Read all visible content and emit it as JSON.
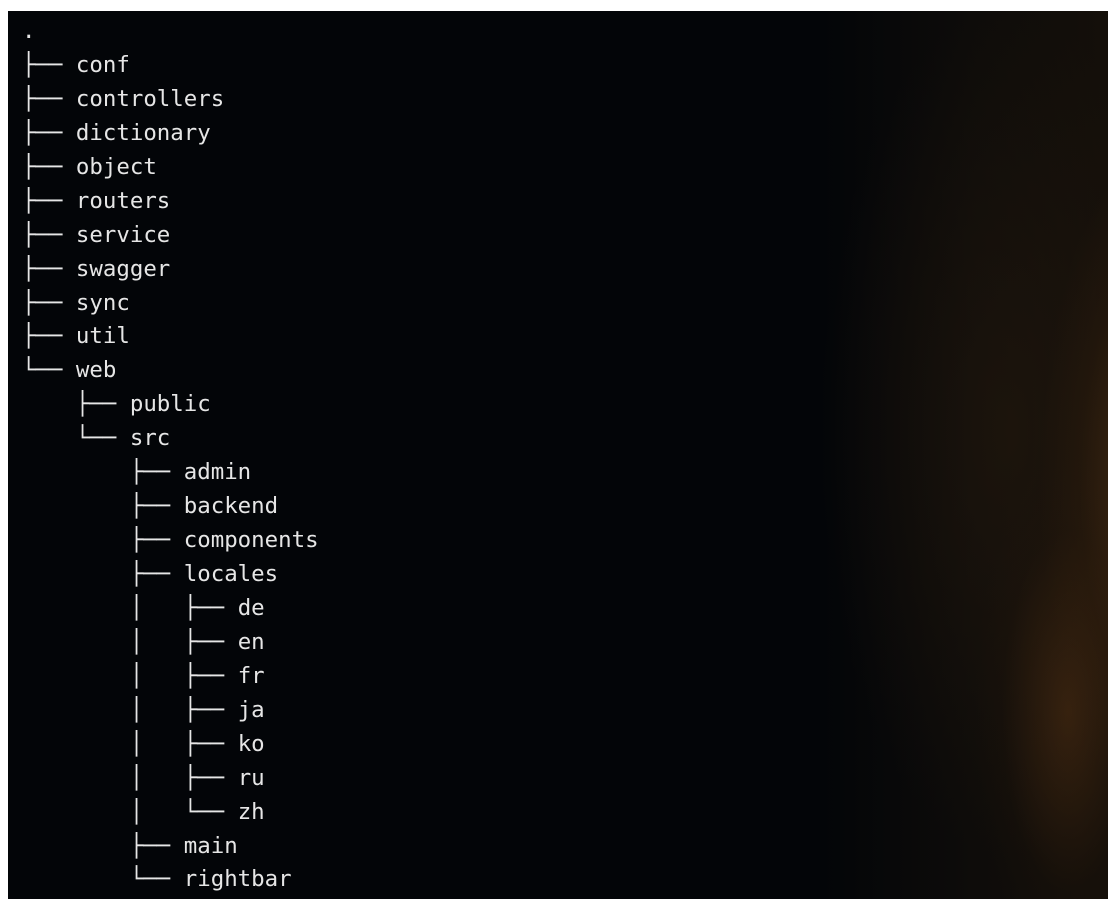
{
  "terminal": {
    "root": ".",
    "lines": [
      {
        "prefix": "├── ",
        "name": "conf"
      },
      {
        "prefix": "├── ",
        "name": "controllers"
      },
      {
        "prefix": "├── ",
        "name": "dictionary"
      },
      {
        "prefix": "├── ",
        "name": "object"
      },
      {
        "prefix": "├── ",
        "name": "routers"
      },
      {
        "prefix": "├── ",
        "name": "service"
      },
      {
        "prefix": "├── ",
        "name": "swagger"
      },
      {
        "prefix": "├── ",
        "name": "sync"
      },
      {
        "prefix": "├── ",
        "name": "util"
      },
      {
        "prefix": "└── ",
        "name": "web"
      },
      {
        "prefix": "    ├── ",
        "name": "public"
      },
      {
        "prefix": "    └── ",
        "name": "src"
      },
      {
        "prefix": "        ├── ",
        "name": "admin"
      },
      {
        "prefix": "        ├── ",
        "name": "backend"
      },
      {
        "prefix": "        ├── ",
        "name": "components"
      },
      {
        "prefix": "        ├── ",
        "name": "locales"
      },
      {
        "prefix": "        │   ├── ",
        "name": "de"
      },
      {
        "prefix": "        │   ├── ",
        "name": "en"
      },
      {
        "prefix": "        │   ├── ",
        "name": "fr"
      },
      {
        "prefix": "        │   ├── ",
        "name": "ja"
      },
      {
        "prefix": "        │   ├── ",
        "name": "ko"
      },
      {
        "prefix": "        │   ├── ",
        "name": "ru"
      },
      {
        "prefix": "        │   └── ",
        "name": "zh"
      },
      {
        "prefix": "        ├── ",
        "name": "main"
      },
      {
        "prefix": "        └── ",
        "name": "rightbar"
      }
    ]
  },
  "colors": {
    "background": "#030508",
    "foreground": "#e6e6e6"
  }
}
